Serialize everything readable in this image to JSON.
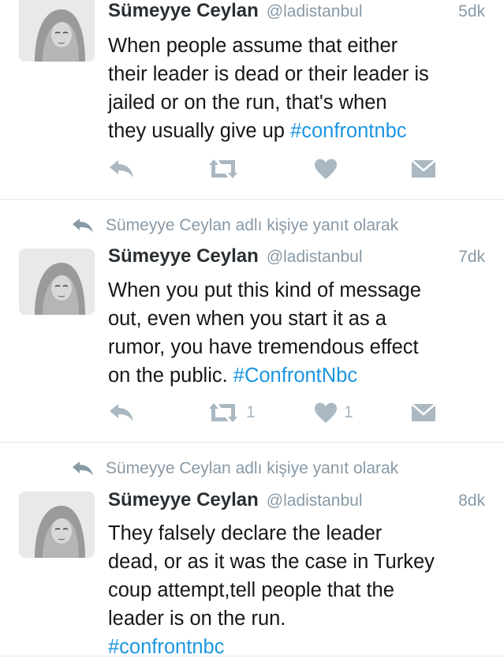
{
  "tweets": [
    {
      "name": "Sümeyye Ceylan",
      "handle": "@ladistanbul",
      "time": "5dk",
      "text": "When people assume that either\ntheir leader is dead or their leader is\njailed or on the run, that's when\nthey usually give up ",
      "hashtag": "#confrontnbc",
      "retweets": "",
      "likes": ""
    },
    {
      "context": "Sümeyye Ceylan adlı kişiye yanıt olarak",
      "name": "Sümeyye Ceylan",
      "handle": "@ladistanbul",
      "time": "7dk",
      "text": "When you put this kind of message\nout, even when you start it as a\nrumor, you have tremendous effect\non the public. ",
      "hashtag": "#ConfrontNbc",
      "retweets": "1",
      "likes": "1"
    },
    {
      "context": "Sümeyye Ceylan adlı kişiye yanıt olarak",
      "name": "Sümeyye Ceylan",
      "handle": "@ladistanbul",
      "time": "8dk",
      "text": "They falsely declare the leader\ndead, or as it was the case in Turkey\ncoup attempt,tell people that the\nleader is on the run.\n",
      "hashtag": "#confrontnbc"
    }
  ],
  "icons": {
    "reply": "reply-icon",
    "retweet": "retweet-icon",
    "like": "heart-icon",
    "dm": "direct-message-icon",
    "avatar": "avatar-image"
  },
  "colors": {
    "hashtag": "#1b95e0",
    "muted": "#8899a6",
    "icon": "#aab8c2",
    "divider": "#e1e8ed"
  }
}
